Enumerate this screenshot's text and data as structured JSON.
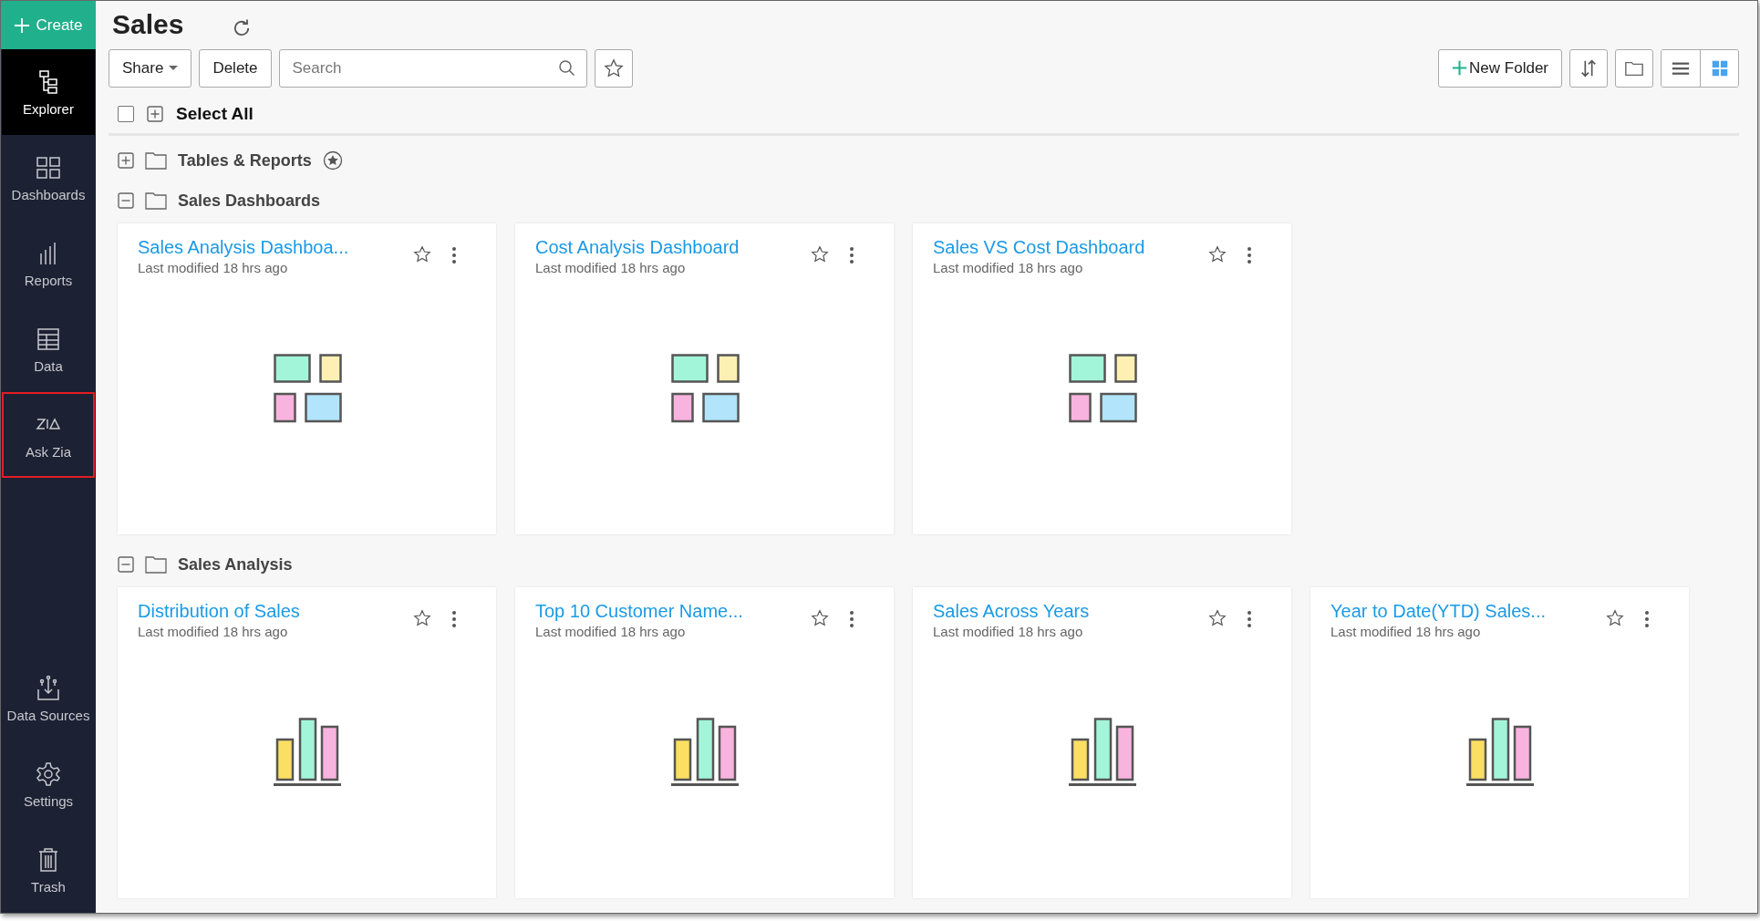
{
  "sidebar": {
    "create_button": {
      "label": "Create"
    },
    "items": [
      {
        "kind": "explorer",
        "label": "Explorer",
        "selected": true,
        "highlighted": false
      },
      {
        "kind": "dashboards",
        "label": "Dashboards",
        "selected": false,
        "highlighted": false
      },
      {
        "kind": "reports",
        "label": "Reports",
        "selected": false,
        "highlighted": false
      },
      {
        "kind": "data",
        "label": "Data",
        "selected": false,
        "highlighted": false
      },
      {
        "kind": "ask-zia",
        "label": "Ask Zia",
        "selected": false,
        "highlighted": true
      }
    ],
    "bottom_items": [
      {
        "kind": "data-sources",
        "label": "Data Sources",
        "selected": false,
        "highlighted": false
      },
      {
        "kind": "settings",
        "label": "Settings",
        "selected": false,
        "highlighted": false
      },
      {
        "kind": "trash",
        "label": "Trash",
        "selected": false,
        "highlighted": false
      }
    ]
  },
  "header": {
    "title": "Sales"
  },
  "toolbar": {
    "share_button": "Share",
    "delete_button": "Delete",
    "search": {
      "placeholder": "Search"
    },
    "new_folder_button": "New Folder",
    "views": [
      {
        "kind": "list",
        "selected": false
      },
      {
        "kind": "grid",
        "selected": true
      }
    ]
  },
  "select_all": {
    "label": "Select All",
    "checked": false
  },
  "folders": [
    {
      "name": "Tables & Reports",
      "expanded": false,
      "starred": true
    },
    {
      "name": "Sales Dashboards",
      "expanded": true,
      "starred": false,
      "items": [
        {
          "kind": "dashboard",
          "title": "Sales Analysis Dashboa...",
          "subtitle": "Last modified 18 hrs ago",
          "favorite": false
        },
        {
          "kind": "dashboard",
          "title": "Cost Analysis Dashboard",
          "subtitle": "Last modified 18 hrs ago",
          "favorite": false
        },
        {
          "kind": "dashboard",
          "title": "Sales VS Cost Dashboard",
          "subtitle": "Last modified 18 hrs ago",
          "favorite": false
        }
      ]
    },
    {
      "name": "Sales Analysis",
      "expanded": true,
      "starred": false,
      "items": [
        {
          "kind": "report",
          "title": "Distribution of Sales",
          "subtitle": "Last modified 18 hrs ago",
          "favorite": false
        },
        {
          "kind": "report",
          "title": "Top 10 Customer Name...",
          "subtitle": "Last modified 18 hrs ago",
          "favorite": false
        },
        {
          "kind": "report",
          "title": "Sales Across Years",
          "subtitle": "Last modified 18 hrs ago",
          "favorite": false
        },
        {
          "kind": "report",
          "title": "Year to Date(YTD) Sales...",
          "subtitle": "Last modified 18 hrs ago",
          "favorite": false
        }
      ]
    }
  ]
}
